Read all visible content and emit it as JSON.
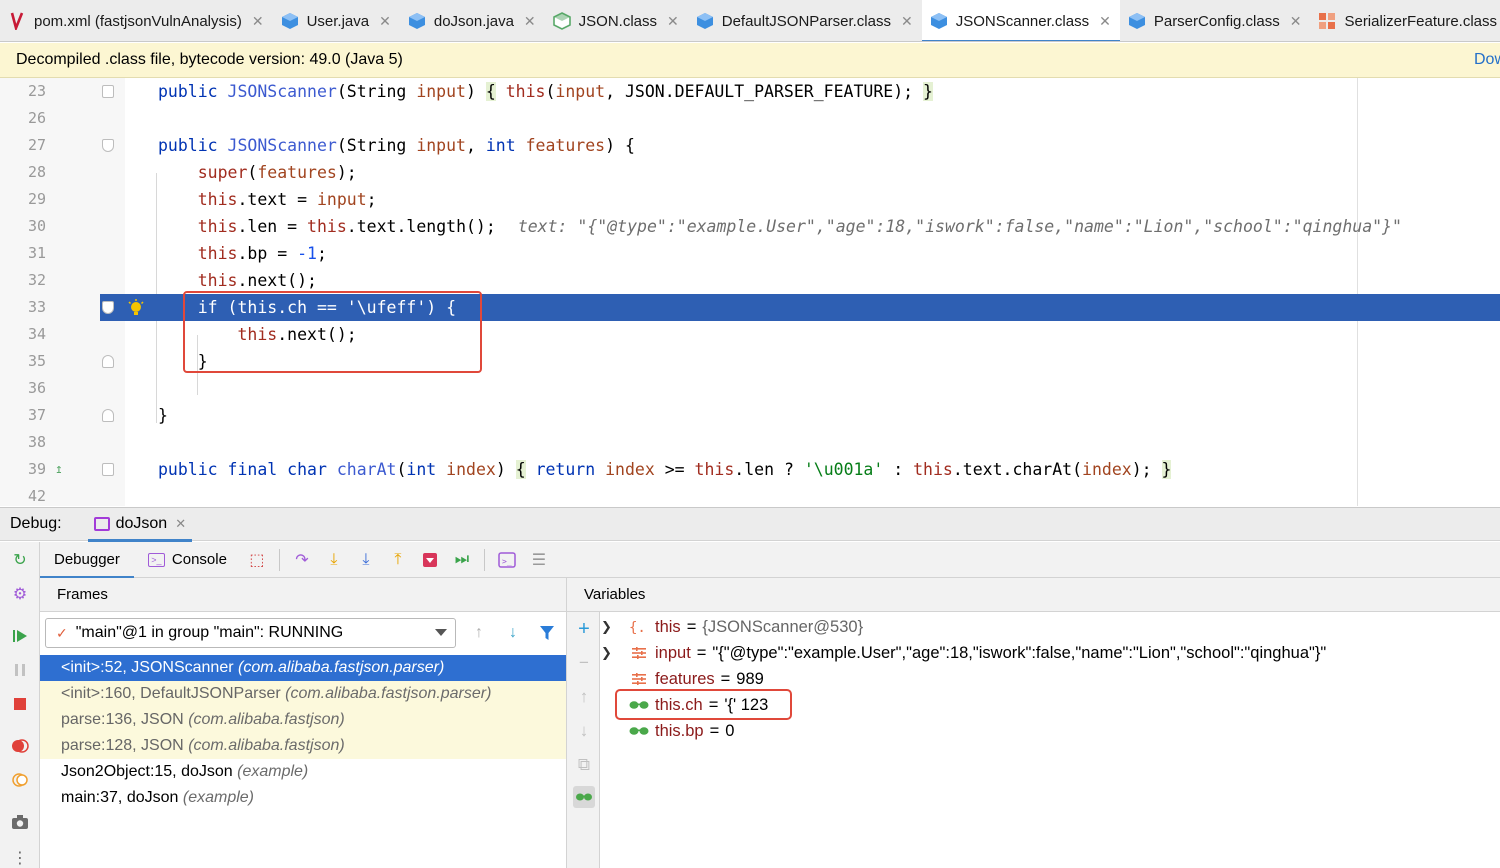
{
  "tabs": [
    {
      "label": "pom.xml (fastjsonVulnAnalysis)",
      "icon": "maven-icon",
      "color": "#c71a36"
    },
    {
      "label": "User.java",
      "icon": "java-class-icon",
      "color": "#3d8fe0"
    },
    {
      "label": "doJson.java",
      "icon": "java-class-icon",
      "color": "#3d8fe0"
    },
    {
      "label": "JSON.class",
      "icon": "abstract-class-icon",
      "color": "#59a869"
    },
    {
      "label": "DefaultJSONParser.class",
      "icon": "java-class-icon",
      "color": "#3d8fe0"
    },
    {
      "label": "JSONScanner.class",
      "icon": "java-class-icon",
      "color": "#3d8fe0",
      "active": true
    },
    {
      "label": "ParserConfig.class",
      "icon": "java-class-icon",
      "color": "#3d8fe0"
    },
    {
      "label": "SerializerFeature.class",
      "icon": "enum-icon",
      "color": "#e8704a"
    }
  ],
  "notice": {
    "text": "Decompiled .class file, bytecode version: 49.0 (Java 5)",
    "action": "Dow"
  },
  "editor": {
    "line_numbers": [
      "23",
      "26",
      "27",
      "28",
      "29",
      "30",
      "31",
      "32",
      "33",
      "34",
      "35",
      "36",
      "37",
      "38",
      "39",
      "42"
    ],
    "highlighted_line": "33",
    "inline_hint": "text: \"{\"@type\":\"example.User\",\"age\":18,\"iswork\":false,\"name\":\"Lion\",\"school\":\"qinghua\"}\""
  },
  "debug": {
    "label": "Debug:",
    "session": "doJson",
    "tabs": [
      "Debugger",
      "Console"
    ],
    "frames_title": "Frames",
    "variables_title": "Variables",
    "thread": "\"main\"@1 in group \"main\": RUNNING",
    "frames": [
      {
        "method": "<init>:52, JSONScanner",
        "pkg": "(com.alibaba.fastjson.parser)",
        "state": "selected"
      },
      {
        "method": "<init>:160, DefaultJSONParser",
        "pkg": "(com.alibaba.fastjson.parser)",
        "state": "lib"
      },
      {
        "method": "parse:136, JSON",
        "pkg": "(com.alibaba.fastjson)",
        "state": "lib"
      },
      {
        "method": "parse:128, JSON",
        "pkg": "(com.alibaba.fastjson)",
        "state": "lib"
      },
      {
        "method": "Json2Object:15, doJson",
        "pkg": "(example)",
        "state": "normal"
      },
      {
        "method": "main:37, doJson",
        "pkg": "(example)",
        "state": "normal"
      }
    ],
    "variables": [
      {
        "name": "this",
        "value": "{JSONScanner@530}",
        "icon": "object-icon",
        "expandable": true
      },
      {
        "name": "input",
        "value": "\"{\"@type\":\"example.User\",\"age\":18,\"iswork\":false,\"name\":\"Lion\",\"school\":\"qinghua\"}\"",
        "icon": "field-icon",
        "expandable": true
      },
      {
        "name": "features",
        "value": "989",
        "icon": "field-icon",
        "expandable": false
      },
      {
        "name": "this.ch",
        "value": "'{' 123",
        "icon": "watch-glasses-icon",
        "expandable": false
      },
      {
        "name": "this.bp",
        "value": "0",
        "icon": "watch-glasses-icon",
        "expandable": false
      }
    ]
  }
}
